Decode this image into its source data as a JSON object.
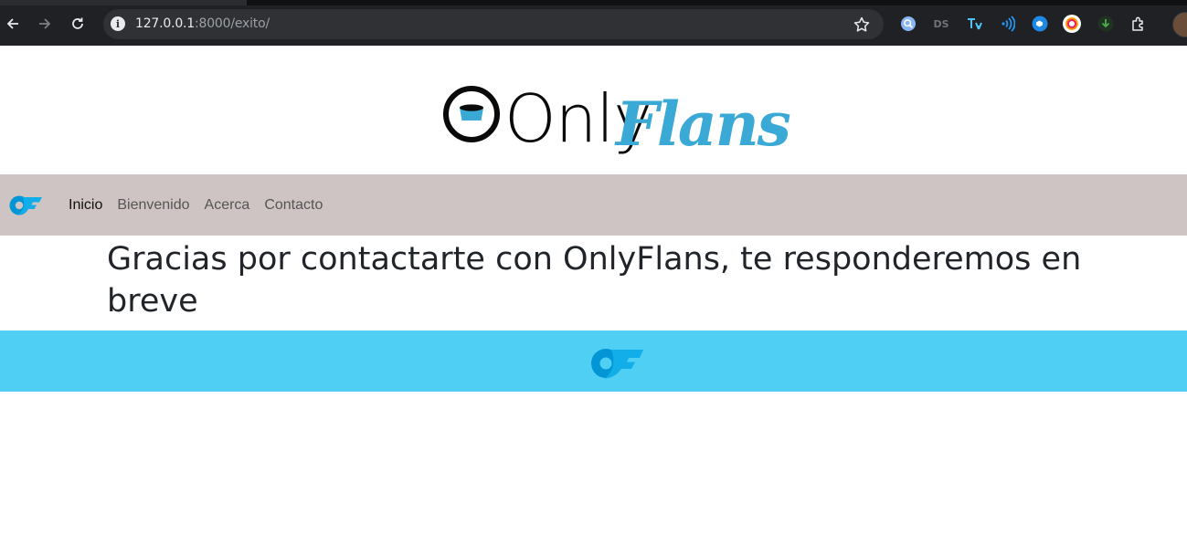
{
  "browser": {
    "url_host": "127.0.0.1",
    "url_path": ":8000/exito/",
    "icons": [
      "back-arrow-icon",
      "forward-arrow-icon",
      "reload-icon",
      "site-info-icon",
      "bookmark-star-icon",
      "extensions-puzzle-icon"
    ],
    "extensions": [
      {
        "name": "ext-search-icon",
        "color": "#8ab4f8"
      },
      {
        "name": "ext-ds-icon",
        "label": "DS",
        "color": "#6f7379"
      },
      {
        "name": "ext-translate-icon",
        "color": "#4fc3f7"
      },
      {
        "name": "ext-wifi-icon",
        "color": "#2196f3"
      },
      {
        "name": "ext-screen-icon",
        "color": "#1e88e5"
      },
      {
        "name": "ext-circle-icon",
        "color": "#ff9800"
      },
      {
        "name": "ext-download-icon",
        "color": "#4caf50"
      }
    ]
  },
  "header": {
    "logo_text_only": "Only",
    "logo_text_flans": "Flans",
    "logo_colors": {
      "dark": "#0a0a0a",
      "accent": "#3aa9d6"
    }
  },
  "navbar": {
    "background": "#cfc4c4",
    "brand_icon": "onlyflans-brand-icon",
    "links": [
      {
        "label": "Inicio",
        "active": true
      },
      {
        "label": "Bienvenido"
      },
      {
        "label": "Acerca"
      },
      {
        "label": "Contacto"
      }
    ]
  },
  "main": {
    "message": "Gracias por contactarte con OnlyFlans, te responderemos en breve"
  },
  "footer": {
    "background": "#50cff4",
    "logo_icon": "onlyflans-footer-icon"
  }
}
